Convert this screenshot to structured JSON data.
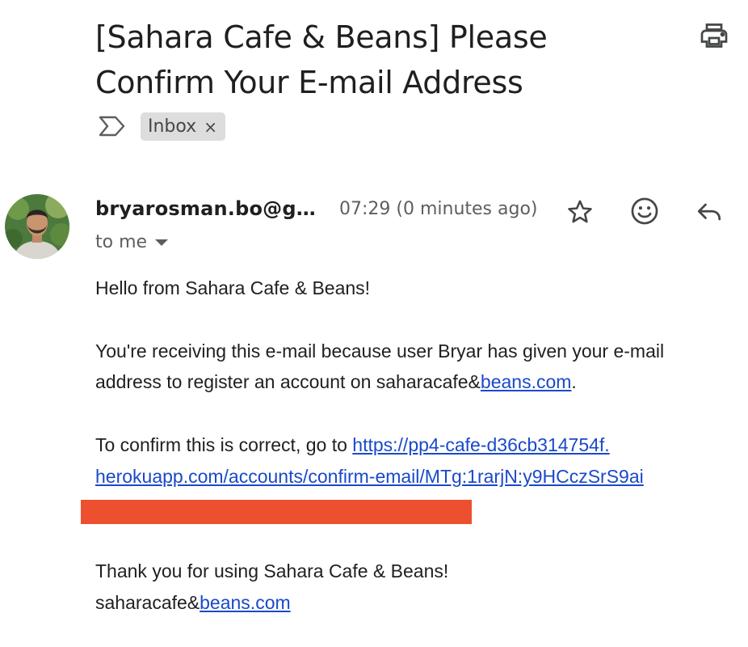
{
  "email": {
    "subject": "[Sahara Cafe & Beans] Please Confirm Your E-mail Address",
    "label": "Inbox",
    "label_remove": "×",
    "sender": "bryarosman.bo@g…",
    "time": "07:29 (0 minutes ago)",
    "recipient": "to me"
  },
  "body": {
    "greeting": "Hello from Sahara Cafe & Beans!",
    "para1_line1": "You're receiving this e-mail because user Bryar has given your e-mail",
    "para1_line2_prefix": "address to register an account on saharacafe&",
    "para1_link": "beans.com",
    "para1_suffix": ".",
    "confirm_prefix": "To confirm this is correct, go to ",
    "confirm_link_line1": "https://pp4-cafe-d36cb314754f.",
    "confirm_link_line2": "herokuapp.com/accounts/confirm-email/MTg:1rarjN:y9HCczSrS9ai",
    "thanks": "Thank you for using Sahara Cafe & Beans!",
    "signature_prefix": "saharacafe&",
    "signature_link": "beans.com"
  },
  "icons": {
    "print": "printer-icon",
    "importance": "importance-marker-icon",
    "star": "star-icon",
    "emoji": "emoji-reaction-icon",
    "reply": "reply-icon",
    "dropdown": "chevron-down-icon"
  },
  "colors": {
    "link": "#1a49c9",
    "redaction": "#ed502f",
    "chip_bg": "#dddddd",
    "muted_text": "#5e5e5e"
  }
}
